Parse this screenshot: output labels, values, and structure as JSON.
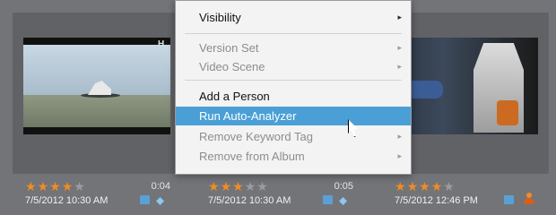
{
  "menu": {
    "items": [
      {
        "label": "Visibility",
        "arrow": "▸",
        "state": "enabled"
      },
      {
        "label": "Version Set",
        "arrow": "▸",
        "state": "disabled"
      },
      {
        "label": "Video Scene",
        "arrow": "▸",
        "state": "disabled"
      },
      {
        "label": "Add a Person",
        "arrow": "",
        "state": "enabled"
      },
      {
        "label": "Run Auto-Analyzer",
        "arrow": "",
        "state": "highlighted"
      },
      {
        "label": "Remove Keyword Tag",
        "arrow": "▸",
        "state": "disabled"
      },
      {
        "label": "Remove from Album",
        "arrow": "▸",
        "state": "disabled"
      }
    ]
  },
  "media": [
    {
      "rating": 4,
      "rating_max": 5,
      "duration": "0:04",
      "date": "7/5/2012 10:30 AM",
      "thumb_badge": "H",
      "icons": [
        "info-square-icon",
        "location-pin-icon"
      ]
    },
    {
      "rating": 3,
      "rating_max": 5,
      "duration": "0:05",
      "date": "7/5/2012 10:30 AM",
      "icons": [
        "info-square-icon",
        "location-pin-icon"
      ]
    },
    {
      "rating": 4,
      "rating_max": 5,
      "duration": "",
      "date": "7/5/2012 12:46 PM",
      "icons": [
        "info-square-icon",
        "person-icon"
      ]
    }
  ],
  "colors": {
    "highlight": "#4aa0d6",
    "star": "#f28c22"
  }
}
